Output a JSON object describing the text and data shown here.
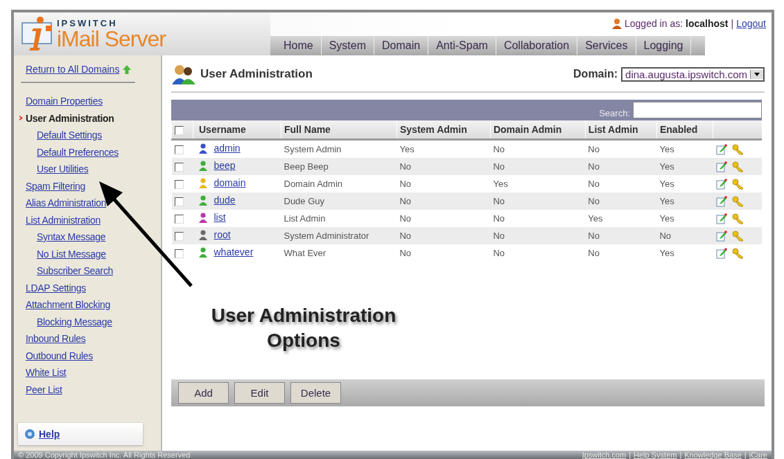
{
  "logo": {
    "brand": "IPSWITCH",
    "product": "iMail Server"
  },
  "user_bar": {
    "label": "Logged in as:",
    "user": "localhost",
    "separator": "|",
    "logout": "Logout"
  },
  "nav_tabs": [
    {
      "label": "Home",
      "selected": false
    },
    {
      "label": "System",
      "selected": false
    },
    {
      "label": "Domain",
      "selected": false
    },
    {
      "label": "Anti-Spam",
      "selected": false
    },
    {
      "label": "Collaboration",
      "selected": false
    },
    {
      "label": "Services",
      "selected": false
    },
    {
      "label": "Logging",
      "selected": false
    }
  ],
  "sidebar": {
    "back_link": "Return to All Domains",
    "items": [
      {
        "label": "Domain Properties",
        "selected": false
      },
      {
        "label": "User Administration",
        "selected": true,
        "children": [
          {
            "label": "Default Settings",
            "selected": false
          },
          {
            "label": "Default Preferences",
            "selected": false
          },
          {
            "label": "User Utilities",
            "selected": false
          }
        ]
      },
      {
        "label": "Spam Filtering",
        "selected": false
      },
      {
        "label": "Alias Administration",
        "selected": false
      },
      {
        "label": "List Administration",
        "selected": false,
        "children": [
          {
            "label": "Syntax Message",
            "selected": false
          },
          {
            "label": "No List Message",
            "selected": false
          },
          {
            "label": "Subscriber Search",
            "selected": false
          }
        ]
      },
      {
        "label": "LDAP Settings",
        "selected": false
      },
      {
        "label": "Attachment Blocking",
        "selected": false,
        "children": [
          {
            "label": "Blocking Message",
            "selected": false
          }
        ]
      },
      {
        "label": "Inbound Rules",
        "selected": false
      },
      {
        "label": "Outbound Rules",
        "selected": false
      },
      {
        "label": "White List",
        "selected": false
      },
      {
        "label": "Peer List",
        "selected": false
      }
    ],
    "help": "Help"
  },
  "page": {
    "title": "User Administration",
    "domain_label": "Domain:",
    "domain_value": "dina.augusta.ipswitch.com"
  },
  "table": {
    "search_label": "Search:",
    "select_all_checked": false,
    "columns": [
      "Username",
      "Full Name",
      "System Admin",
      "Domain Admin",
      "List Admin",
      "Enabled"
    ],
    "rows": [
      {
        "checked": false,
        "color": "#3a4fc8",
        "username": "admin",
        "full_name": "System Admin",
        "system_admin": "Yes",
        "domain_admin": "No",
        "list_admin": "No",
        "enabled": "Yes"
      },
      {
        "checked": false,
        "color": "#3fae3a",
        "username": "beep",
        "full_name": "Beep Beep",
        "system_admin": "No",
        "domain_admin": "No",
        "list_admin": "No",
        "enabled": "Yes"
      },
      {
        "checked": false,
        "color": "#e8b820",
        "username": "domain",
        "full_name": "Domain Admin",
        "system_admin": "No",
        "domain_admin": "Yes",
        "list_admin": "No",
        "enabled": "Yes"
      },
      {
        "checked": false,
        "color": "#3fae3a",
        "username": "dude",
        "full_name": "Dude Guy",
        "system_admin": "No",
        "domain_admin": "No",
        "list_admin": "No",
        "enabled": "Yes"
      },
      {
        "checked": false,
        "color": "#b83aa8",
        "username": "list",
        "full_name": "List Admin",
        "system_admin": "No",
        "domain_admin": "No",
        "list_admin": "Yes",
        "enabled": "Yes"
      },
      {
        "checked": false,
        "color": "#6a6a6a",
        "username": "root",
        "full_name": "System Administrator",
        "system_admin": "No",
        "domain_admin": "No",
        "list_admin": "No",
        "enabled": "No"
      },
      {
        "checked": false,
        "color": "#3fae3a",
        "username": "whatever",
        "full_name": "What Ever",
        "system_admin": "No",
        "domain_admin": "No",
        "list_admin": "No",
        "enabled": "Yes"
      }
    ]
  },
  "buttons": [
    "Add",
    "Edit",
    "Delete"
  ],
  "annotation": "User Administration Options",
  "footer": {
    "copyright": "© 2009 Copyright Ipswitch Inc. All Rights Reserved",
    "links": [
      "Ipswitch.com",
      "Help System",
      "Knowledge Base",
      "iCare"
    ],
    "separator": "|"
  }
}
